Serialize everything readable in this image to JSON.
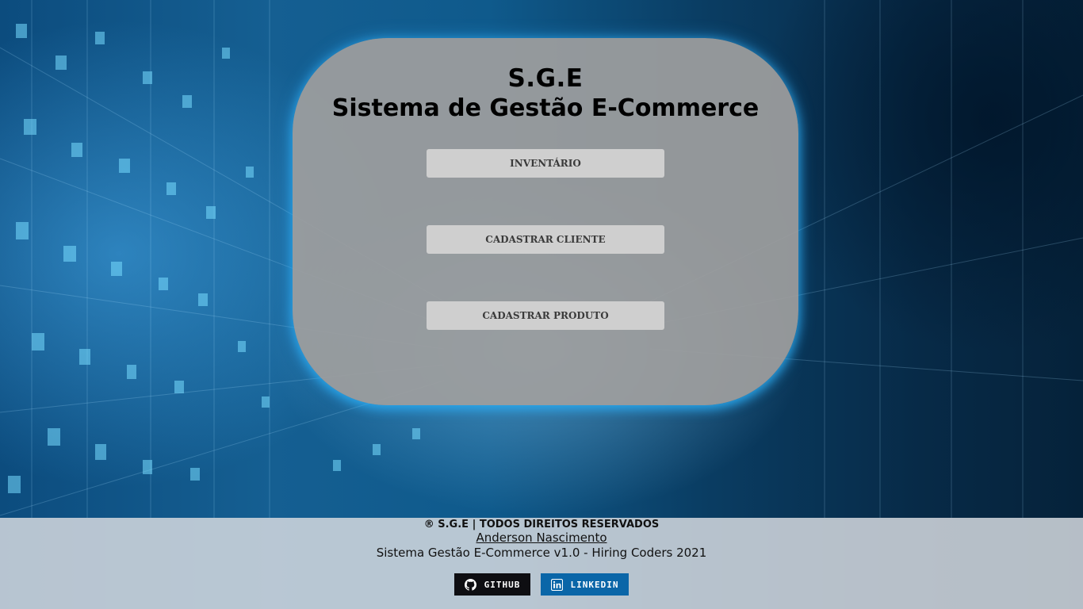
{
  "header": {
    "title": "S.G.E",
    "subtitle": "Sistema de Gestão E-Commerce"
  },
  "menu": {
    "inventory_label": "INVENTÁRIO",
    "register_client_label": "CADASTRAR CLIENTE",
    "register_product_label": "CADASTRAR PRODUTO"
  },
  "footer": {
    "copyright": "® S.G.E | TODOS DIREITOS RESERVADOS",
    "author": "Anderson Nascimento",
    "version": "Sistema Gestão E-Commerce v1.0 - Hiring Coders 2021",
    "github_label": "GITHUB",
    "linkedin_label": "LINKEDIN"
  },
  "colors": {
    "panel": "#9e9e9e",
    "button": "#cfcfcf",
    "panel_glow": "#28aaf0",
    "github_badge": "#0e0e12",
    "linkedin_badge": "#0a66a8"
  },
  "icons": {
    "github": "github-icon",
    "linkedin": "linkedin-icon"
  }
}
